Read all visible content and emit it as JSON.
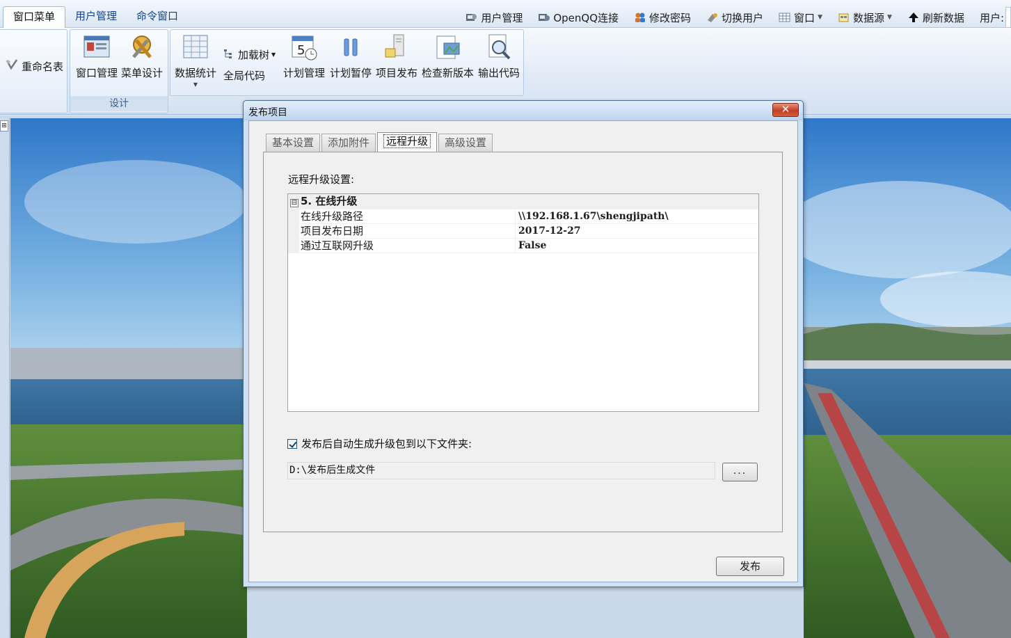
{
  "ribbon_tabs": [
    {
      "label": "窗口菜单",
      "active": true
    },
    {
      "label": "用户管理",
      "active": false
    },
    {
      "label": "命令窗口",
      "active": false
    }
  ],
  "quick_access": [
    {
      "label": "用户管理",
      "icon": "user-manage-icon"
    },
    {
      "label": "OpenQQ连接",
      "icon": "qq-connect-icon"
    },
    {
      "label": "修改密码",
      "icon": "users-icon"
    },
    {
      "label": "切换用户",
      "icon": "switch-user-icon"
    },
    {
      "label": "窗口",
      "icon": "window-grid-icon"
    },
    {
      "label": "数据源",
      "icon": "datasource-icon"
    },
    {
      "label": "刷新数据",
      "icon": "up-arrow-icon"
    },
    {
      "label": "用户:",
      "icon": ""
    }
  ],
  "ribbon": {
    "rename_table": "重命名表",
    "design_group": {
      "label": "设计",
      "window_manage": "窗口管理",
      "menu_design": "菜单设计"
    },
    "data_stats": "数据统计",
    "load_tree": "加载树",
    "global_code": "全局代码",
    "plan_manage": "计划管理",
    "plan_pause": "计划暂停",
    "project_publish": "项目发布",
    "check_version": "检查新版本",
    "export_code": "输出代码"
  },
  "dialog": {
    "title": "发布项目",
    "close_symbol": "✕",
    "tabs": [
      {
        "label": "基本设置",
        "active": false
      },
      {
        "label": "添加附件",
        "active": false
      },
      {
        "label": "远程升级",
        "active": true
      },
      {
        "label": "高级设置",
        "active": false
      }
    ],
    "section_label": "远程升级设置:",
    "property_grid": {
      "category": "5. 在线升级",
      "toggle": "⊟",
      "rows": [
        {
          "name": "在线升级路径",
          "value": "\\\\192.168.1.67\\shengjipath\\"
        },
        {
          "name": "项目发布日期",
          "value": "2017-12-27"
        },
        {
          "name": "通过互联网升级",
          "value": "False"
        }
      ]
    },
    "auto_package": {
      "label": "发布后自动生成升级包到以下文件夹:",
      "checked": true
    },
    "output_path": "D:\\发布后生成文件",
    "browse_label": "...",
    "publish_label": "发布"
  }
}
